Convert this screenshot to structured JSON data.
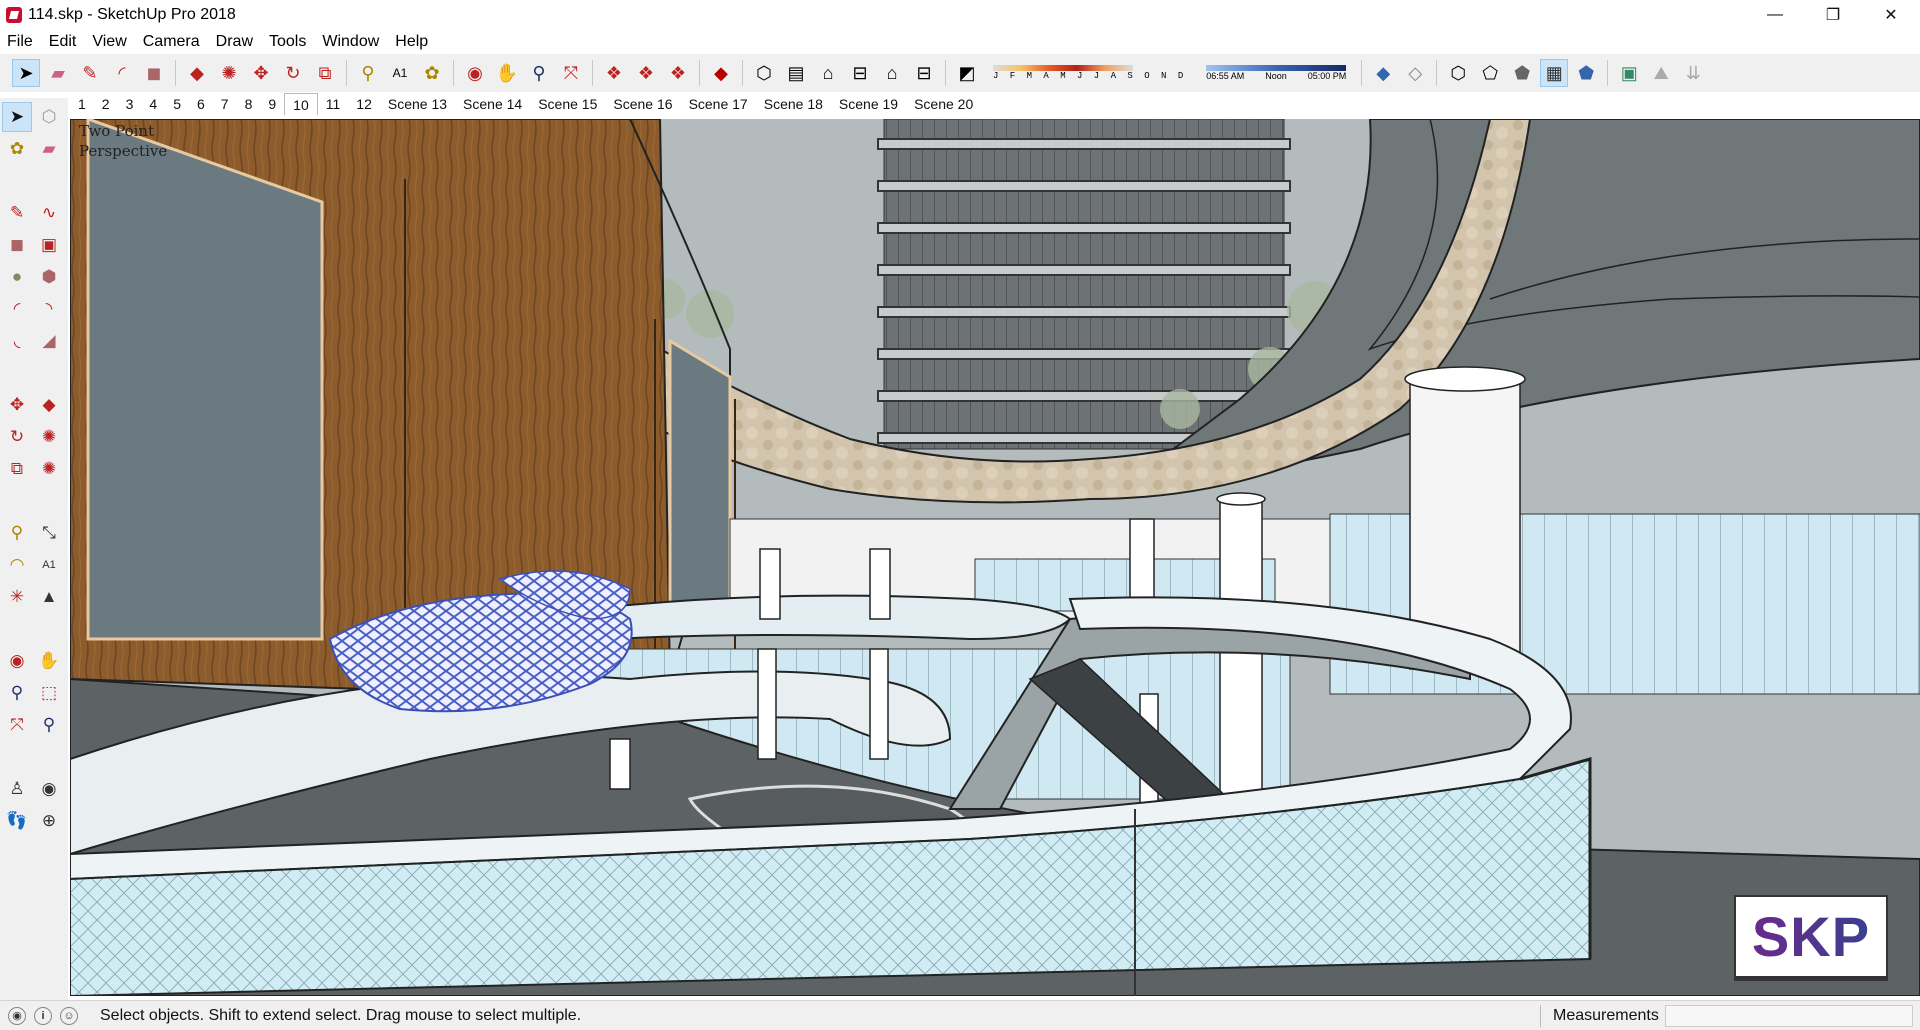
{
  "window": {
    "title": "114.skp - SketchUp Pro 2018",
    "minimize_glyph": "—",
    "restore_glyph": "❐",
    "close_glyph": "✕"
  },
  "menu": [
    "File",
    "Edit",
    "View",
    "Camera",
    "Draw",
    "Tools",
    "Window",
    "Help"
  ],
  "toolbar": {
    "shadow_months": "J F M A M J J A S O N D",
    "time_start": "06:55 AM",
    "time_mid": "Noon",
    "time_end": "05:00 PM"
  },
  "scenes": {
    "tabs": [
      "1",
      "2",
      "3",
      "4",
      "5",
      "6",
      "7",
      "8",
      "9",
      "10",
      "11",
      "12",
      "Scene 13",
      "Scene 14",
      "Scene 15",
      "Scene 16",
      "Scene 17",
      "Scene 18",
      "Scene 19",
      "Scene 20"
    ],
    "active": "10"
  },
  "viewport": {
    "camera_label": "Two Point\nPerspective",
    "logo": "SKP"
  },
  "statusbar": {
    "message": "Select objects. Shift to extend select. Drag mouse to select multiple.",
    "measurements_label": "Measurements",
    "measurements_value": ""
  },
  "icons": {
    "toolbar": [
      "select-arrow-icon",
      "eraser-icon",
      "pencil-icon",
      "arc-icon",
      "paint-bucket-icon",
      "push-pull-icon",
      "follow-me-icon",
      "move-icon",
      "rotate-icon",
      "scale-icon",
      "tape-measure-icon",
      "text-icon",
      "paint-icon",
      "orbit-icon",
      "pan-icon",
      "zoom-icon",
      "zoom-extents-icon"
    ],
    "palette": [
      "select-icon",
      "component-icon",
      "paint-bucket-icon",
      "eraser-icon",
      "line-icon",
      "freehand-icon",
      "rectangle-icon",
      "rotated-rectangle-icon",
      "circle-icon",
      "polygon-icon",
      "arc-icon",
      "two-point-arc-icon",
      "three-point-arc-icon",
      "pie-icon",
      "move-icon",
      "push-pull-icon",
      "rotate-icon",
      "follow-me-icon",
      "scale-icon",
      "offset-icon",
      "tape-measure-icon",
      "dimension-icon",
      "protractor-icon",
      "text-icon",
      "axes-icon",
      "3d-text-icon",
      "orbit-icon",
      "pan-icon",
      "zoom-icon",
      "zoom-window-icon",
      "zoom-extents-icon",
      "previous-view-icon",
      "position-camera-icon",
      "look-around-icon",
      "walk-icon",
      "section-plane-icon"
    ]
  },
  "colors": {
    "sky": "#b4bbbd",
    "wood": "#8a5a2a",
    "glass": "#cfe8f2",
    "accent_selection": "#cce4f7"
  }
}
